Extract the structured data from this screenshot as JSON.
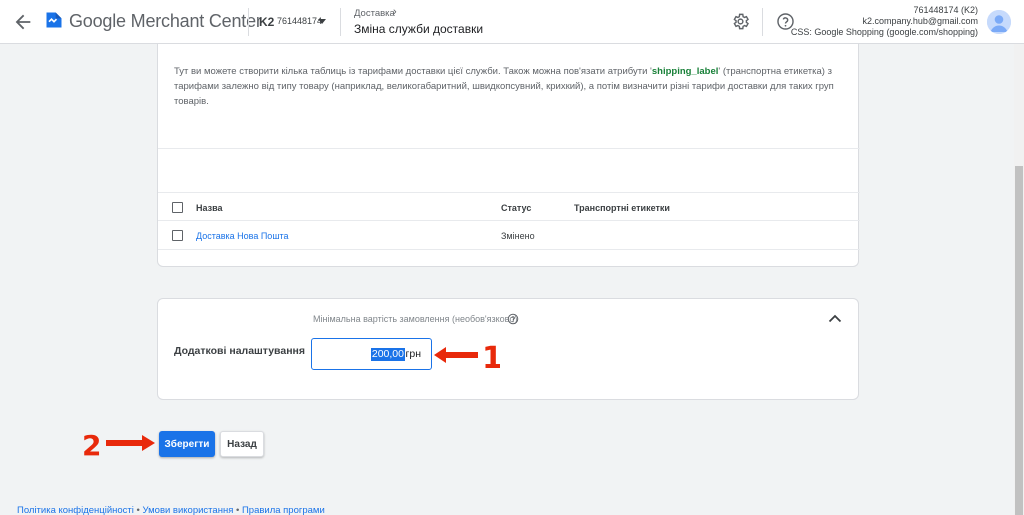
{
  "header": {
    "brand": "Google Merchant Center",
    "account_name": "K2",
    "account_id": "761448174",
    "breadcrumb": "Доставка",
    "page_title": "Зміна служби доставки",
    "user_line1": "761448174 (K2)",
    "user_line2": "k2.company.hub@gmail.com",
    "user_line3": "CSS: Google Shopping (google.com/shopping)"
  },
  "description": {
    "part1": "Тут ви можете створити кілька таблиць із тарифами доставки цієї служби. Також можна пов'язати атрибути '",
    "code": "shipping_label",
    "part2": "' (транспортна етикетка) з тарифами залежно від типу товару (наприклад, великогабаритний, швидкопсувний, крихкий), а потім визначити різні тарифи доставки для таких груп товарів."
  },
  "table": {
    "columns": [
      "Назва",
      "Статус",
      "Транспортні етикетки"
    ],
    "rows": [
      {
        "name": "Доставка Нова Пошта",
        "status": "Змінено",
        "labels": ""
      }
    ]
  },
  "additional": {
    "label": "Додаткові налаштування",
    "min_order_label": "Мінімальна вартість замовлення (необов'язково)",
    "amount": "200,00",
    "currency": "грн"
  },
  "annotations": {
    "marker1": "1",
    "marker2": "2",
    "color": "#e8290b"
  },
  "buttons": {
    "save": "Зберегти",
    "back": "Назад"
  },
  "footer": {
    "privacy": "Політика конфіденційності",
    "terms": "Умови використання",
    "program": "Правила програми"
  },
  "colors": {
    "accent": "#1a73e8",
    "code": "#188038"
  }
}
